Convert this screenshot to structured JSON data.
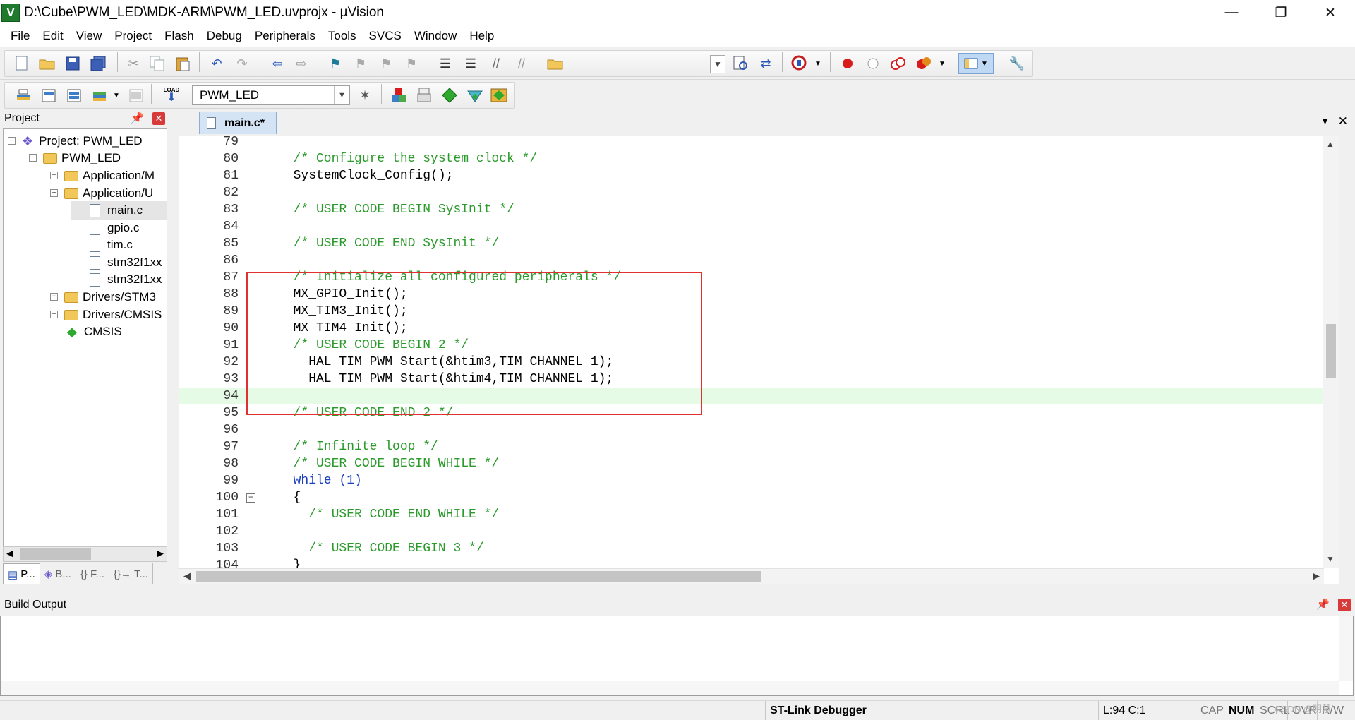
{
  "window": {
    "title": "D:\\Cube\\PWM_LED\\MDK-ARM\\PWM_LED.uvprojx - µVision",
    "app_icon_label": "V",
    "controls": [
      "—",
      "❐",
      "✕"
    ]
  },
  "menu": [
    "File",
    "Edit",
    "View",
    "Project",
    "Flash",
    "Debug",
    "Peripherals",
    "Tools",
    "SVCS",
    "Window",
    "Help"
  ],
  "toolbar2": {
    "target_name": "PWM_LED",
    "load_label": "LOAD"
  },
  "project_pane": {
    "title": "Project",
    "pin": "⊞",
    "close": "✕",
    "tree": [
      {
        "label": "Project: PWM_LED"
      },
      {
        "label": "PWM_LED"
      },
      {
        "label": "Application/M"
      },
      {
        "label": "Application/U"
      },
      {
        "label": "main.c"
      },
      {
        "label": "gpio.c"
      },
      {
        "label": "tim.c"
      },
      {
        "label": "stm32f1xx"
      },
      {
        "label": "stm32f1xx"
      },
      {
        "label": "Drivers/STM3"
      },
      {
        "label": "Drivers/CMSIS"
      },
      {
        "label": "CMSIS"
      }
    ],
    "tabs": [
      "P...",
      "B...",
      "{} F...",
      "{}→ T..."
    ]
  },
  "editor": {
    "tab": "main.c*",
    "lines": [
      {
        "n": "79",
        "t": "",
        "c": ""
      },
      {
        "n": "80",
        "t": "  /* Configure the system clock */",
        "c": "cmt"
      },
      {
        "n": "81",
        "t": "  SystemClock_Config();",
        "c": ""
      },
      {
        "n": "82",
        "t": "",
        "c": ""
      },
      {
        "n": "83",
        "t": "  /* USER CODE BEGIN SysInit */",
        "c": "cmt"
      },
      {
        "n": "84",
        "t": "",
        "c": ""
      },
      {
        "n": "85",
        "t": "  /* USER CODE END SysInit */",
        "c": "cmt"
      },
      {
        "n": "86",
        "t": "",
        "c": ""
      },
      {
        "n": "87",
        "t": "  /* Initialize all configured peripherals */",
        "c": "cmt"
      },
      {
        "n": "88",
        "t": "  MX_GPIO_Init();",
        "c": ""
      },
      {
        "n": "89",
        "t": "  MX_TIM3_Init();",
        "c": ""
      },
      {
        "n": "90",
        "t": "  MX_TIM4_Init();",
        "c": ""
      },
      {
        "n": "91",
        "t": "  /* USER CODE BEGIN 2 */",
        "c": "cmt"
      },
      {
        "n": "92",
        "t": "    HAL_TIM_PWM_Start(&htim3,TIM_CHANNEL_1);",
        "c": ""
      },
      {
        "n": "93",
        "t": "    HAL_TIM_PWM_Start(&htim4,TIM_CHANNEL_1);",
        "c": ""
      },
      {
        "n": "94",
        "t": "",
        "c": "hl"
      },
      {
        "n": "95",
        "t": "  /* USER CODE END 2 */",
        "c": "cmt"
      },
      {
        "n": "96",
        "t": "",
        "c": ""
      },
      {
        "n": "97",
        "t": "  /* Infinite loop */",
        "c": "cmt"
      },
      {
        "n": "98",
        "t": "  /* USER CODE BEGIN WHILE */",
        "c": "cmt"
      },
      {
        "n": "99",
        "t": "  while (1)",
        "c": "kw"
      },
      {
        "n": "100",
        "t": "  {",
        "c": "fold"
      },
      {
        "n": "101",
        "t": "    /* USER CODE END WHILE */",
        "c": "cmt"
      },
      {
        "n": "102",
        "t": "",
        "c": ""
      },
      {
        "n": "103",
        "t": "    /* USER CODE BEGIN 3 */",
        "c": "cmt"
      },
      {
        "n": "104",
        "t": "  }",
        "c": "cut"
      }
    ]
  },
  "build_output": {
    "title": "Build Output"
  },
  "status": {
    "debugger": "ST-Link Debugger",
    "position": "L:94 C:1",
    "cap": "CAP",
    "num": "NUM",
    "scrl": "SCRL",
    "ovr": "OVR",
    "rw": "R/W",
    "watermark": "CSDN @明慧"
  },
  "colors": {
    "comment": "#2a9a2a",
    "keyword": "#1a3fbf",
    "current_line": "#e6fbe6",
    "highlight_box": "#e03030"
  }
}
